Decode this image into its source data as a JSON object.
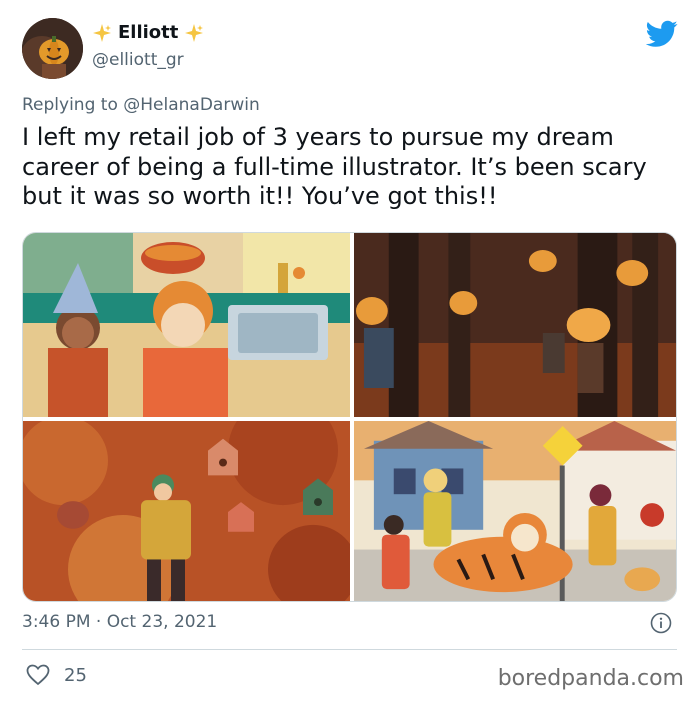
{
  "author": {
    "display_name": "Elliott",
    "handle": "@elliott_gr",
    "avatar_icon": "pumpkin-avatar",
    "sparkle_icon": "sparkles"
  },
  "reply": {
    "prefix": "Replying to",
    "mention": "@HelanaDarwin"
  },
  "tweet": {
    "text": "I left my retail job of 3 years to pursue my dream career of being a full-time illustrator. It’s been scary but it was so worth it!! You’ve got this!!",
    "timestamp": "3:46 PM · Oct 23, 2021",
    "likes": "25"
  },
  "media": [
    {
      "name": "kitchen-illustration"
    },
    {
      "name": "forest-pumpkins-illustration"
    },
    {
      "name": "leaves-birdhouses-illustration"
    },
    {
      "name": "tiger-street-illustration"
    }
  ],
  "watermark": "boredpanda.com",
  "colors": {
    "twitter_blue": "#1d9bf0",
    "text_primary": "#0f1419",
    "text_secondary": "#536471",
    "border": "#cfd9de"
  }
}
